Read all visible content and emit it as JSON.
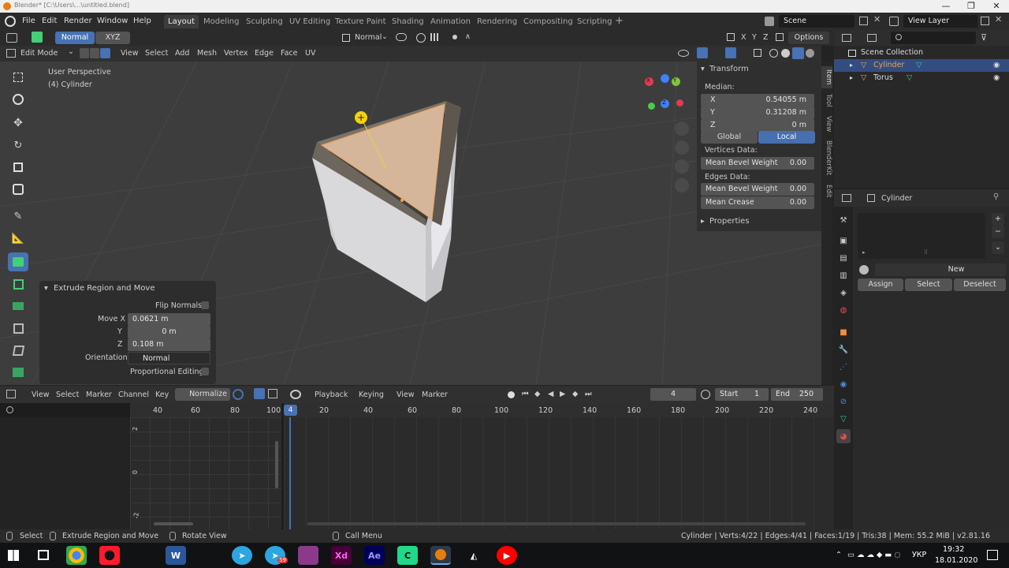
{
  "window": {
    "title": "Blender* [C:\\Users\\...\\untitled.blend]",
    "minimize": "—",
    "maximize": "❐",
    "close": "✕"
  },
  "menus": [
    "File",
    "Edit",
    "Render",
    "Window",
    "Help"
  ],
  "workspaces": [
    "Layout",
    "Modeling",
    "Sculpting",
    "UV Editing",
    "Texture Paint",
    "Shading",
    "Animation",
    "Rendering",
    "Compositing",
    "Scripting"
  ],
  "active_workspace": "Layout",
  "scene": {
    "label": "Scene",
    "view_layer": "View Layer"
  },
  "header": {
    "orientation_btn": "Normal",
    "axis_btn": "XYZ",
    "transform_orientation": "Normal",
    "axes": [
      "X",
      "Y",
      "Z"
    ],
    "options": "Options"
  },
  "viewport_header": {
    "mode": "Edit Mode",
    "menus": [
      "View",
      "Select",
      "Add",
      "Mesh",
      "Vertex",
      "Edge",
      "Face",
      "UV"
    ]
  },
  "viewport": {
    "perspective": "User Perspective",
    "object": "(4) Cylinder",
    "gizmo": {
      "x": "X",
      "y": "Y",
      "z": "Z"
    }
  },
  "npanel": {
    "transform_title": "Transform",
    "median_label": "Median:",
    "x": {
      "label": "X",
      "value": "0.54055 m"
    },
    "y": {
      "label": "Y",
      "value": "0.31208 m"
    },
    "z": {
      "label": "Z",
      "value": "0 m"
    },
    "global": "Global",
    "local": "Local",
    "vertices_data": "Vertices Data:",
    "mean_bevel_weight_v": {
      "label": "Mean Bevel Weight",
      "value": "0.00"
    },
    "edges_data": "Edges Data:",
    "mean_bevel_weight_e": {
      "label": "Mean Bevel Weight",
      "value": "0.00"
    },
    "mean_crease": {
      "label": "Mean Crease",
      "value": "0.00"
    },
    "properties_title": "Properties",
    "tabs": [
      "Item",
      "Tool",
      "View",
      "BlenderKit",
      "Edit"
    ]
  },
  "operator_panel": {
    "title": "Extrude Region and Move",
    "flip_normals": "Flip Normals",
    "move_x": {
      "label": "Move X",
      "value": "0.0621 m"
    },
    "y": {
      "label": "Y",
      "value": "0 m"
    },
    "z": {
      "label": "Z",
      "value": "0.108 m"
    },
    "orientation": {
      "label": "Orientation",
      "value": "Normal"
    },
    "proportional": "Proportional Editing"
  },
  "graph_header": {
    "menus": [
      "View",
      "Select",
      "Marker",
      "Channel",
      "Key"
    ],
    "normalize": "Normalize"
  },
  "graph_ruler": [
    "40",
    "60",
    "80",
    "100"
  ],
  "graph_yticks": [
    "2",
    "0",
    "-2"
  ],
  "timeline_header": {
    "menus": [
      "Playback",
      "Keying",
      "View",
      "Marker"
    ],
    "current_frame": "4",
    "start_label": "Start",
    "start": "1",
    "end_label": "End",
    "end": "250"
  },
  "timeline_ruler": [
    "20",
    "40",
    "60",
    "80",
    "100",
    "120",
    "140",
    "160",
    "180",
    "200",
    "220",
    "240"
  ],
  "playhead": "4",
  "outliner": {
    "root": "Scene Collection",
    "items": [
      {
        "name": "Cylinder",
        "selected": true
      },
      {
        "name": "Torus",
        "selected": false
      }
    ]
  },
  "properties": {
    "object_name": "Cylinder",
    "new_btn": "New",
    "assign": "Assign",
    "select": "Select",
    "deselect": "Deselect"
  },
  "status": {
    "select": "Select",
    "extrude": "Extrude Region and Move",
    "rotate": "Rotate View",
    "call_menu": "Call Menu",
    "stats": "Cylinder | Verts:4/22 | Edges:4/41 | Faces:1/19 | Tris:38 | Mem: 55.2 MiB | v2.81.16"
  },
  "taskbar": {
    "apps": [
      "Chrome",
      "Opera",
      "Word",
      "Telegram",
      "Telegram",
      "WinRAR",
      "Xd",
      "Ae",
      "PyCharm",
      "Blender",
      "Unity",
      "YouTube"
    ],
    "telegram_badge": "59",
    "lang": "УКР",
    "time": "19:32",
    "date": "18.01.2020"
  },
  "colors": {
    "accent": "#4772b3",
    "face": "#d6b69a",
    "cursor": "#f5d10e"
  }
}
